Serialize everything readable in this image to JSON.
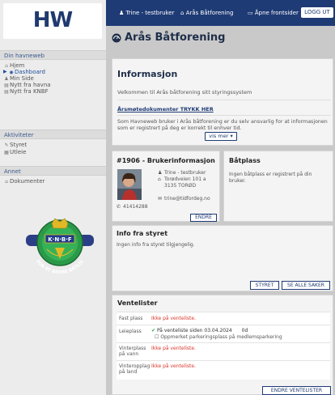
{
  "colors": {
    "navy": "#1f3b75",
    "red_status": "#d9372c",
    "green_status": "#2e9c4a"
  },
  "sidebar": {
    "logo": "HW",
    "sections": {
      "havneweb": "Din havneweb",
      "aktiviteter": "Aktiviteter",
      "annet": "Annet"
    },
    "items": {
      "hjem": {
        "label": "Hjem",
        "icon": "home-icon"
      },
      "dashboard": {
        "label": "Dashboard",
        "icon": "dashboard-icon"
      },
      "minside": {
        "label": "Min Side",
        "icon": "user-icon"
      },
      "nytt_havna": {
        "label": "Nytt fra havna",
        "icon": "news-icon"
      },
      "nytt_knbf": {
        "label": "Nytt fra KNBF",
        "icon": "news-icon"
      },
      "styret": {
        "label": "Styret",
        "icon": "pen-icon"
      },
      "utleie": {
        "label": "Utleie",
        "icon": "calendar-icon"
      },
      "dokumenter": {
        "label": "Dokumenter",
        "icon": "building-icon"
      }
    },
    "seal_text": {
      "top": "K·N·B·F",
      "bottom": "FOR ET BEDRE BÅTLIV"
    }
  },
  "topbar": {
    "user": "Trine - testbruker",
    "club": "Arås Båtforening",
    "open_front": "Åpne frontsider",
    "logout": "LOGG UT"
  },
  "page": {
    "title": "Arås Båtforening"
  },
  "info": {
    "title": "Informasjon",
    "welcome": "Velkommen til Arås båtforening sitt styringssystem",
    "link": "Årsmøtedokumenter TRYKK HER",
    "body": "Som Havneweb bruker i Arås båtforening er du selv ansvarlig for at informasjonen som er registrert på deg er korrekt til enhver tid.",
    "more": "vis mer"
  },
  "user": {
    "title": "#1906 - Brukerinformasjon",
    "name": "Trine - testbruker",
    "address1": "Torødveien 101 a",
    "address2": "3135 TORØD",
    "email": "trine@tidfordeg.no",
    "phone": "41414288",
    "edit": "ENDRE"
  },
  "boat": {
    "title": "Båtplass",
    "text": "Ingen båtplass er registrert på din bruker."
  },
  "board": {
    "title": "Info fra styret",
    "text": "Ingen info fra styret tilgjengelig.",
    "btn_styret": "STYRET",
    "btn_all": "SE ALLE SAKER"
  },
  "waitlist": {
    "title": "Ventelister",
    "rows": [
      {
        "label": "Fast plass",
        "status": "Ikke på venteliste."
      },
      {
        "label": "Leieplass",
        "status": "På venteliste siden 03.04.2024",
        "days": "0d",
        "sub": "Oppmerket parkeringsplass på medlemsparkering"
      },
      {
        "label": "Vinterplass på vann",
        "status": "Ikke på venteliste."
      },
      {
        "label": "Vinteropplag på land",
        "status": "Ikke på venteliste."
      }
    ],
    "edit": "ENDRE VENTELISTER"
  }
}
